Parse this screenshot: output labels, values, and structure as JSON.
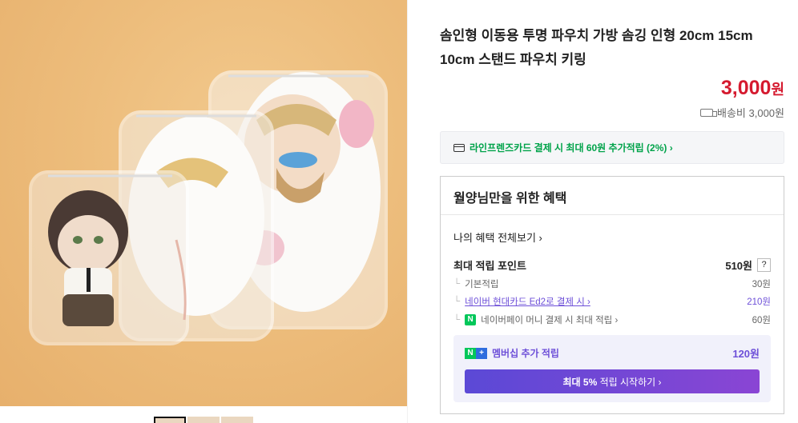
{
  "product": {
    "title": "솜인형 이동용 투명 파우치 가방 솜깅 인형 20cm 15cm 10cm 스탠드 파우치 키링",
    "price": "3,000",
    "price_unit": "원",
    "shipping": "배송비 3,000원"
  },
  "card_banner": {
    "text": "라인프렌즈카드 결제 시 최대 60원 추가적립 (2%) ›"
  },
  "benefit": {
    "heading": "월양님만을 위한 혜택",
    "my_benefits_link": "나의 혜택 전체보기 ›",
    "max_points_label": "최대 적립 포인트",
    "max_points_value": "510원",
    "help": "?",
    "rows": [
      {
        "label": "기본적립",
        "value": "30원"
      },
      {
        "label": "네이버 현대카드 Ed2로 결제 시 ›",
        "value": "210원"
      },
      {
        "label": "네이버페이 머니 결제 시 최대 적립 ›",
        "value": "60원"
      }
    ],
    "membership": {
      "label": "멤버십 추가 적립",
      "value": "120원",
      "button_bold": "최대 5%",
      "button_rest": " 적립 시작하기 ›"
    }
  },
  "icons": [
    "truck-icon",
    "card-icon",
    "naver-pay-icon",
    "naver-plus-icon"
  ],
  "colors": {
    "price": "#d51a2f",
    "accent_green": "#00a34a",
    "accent_purple": "#6d4fd8"
  }
}
